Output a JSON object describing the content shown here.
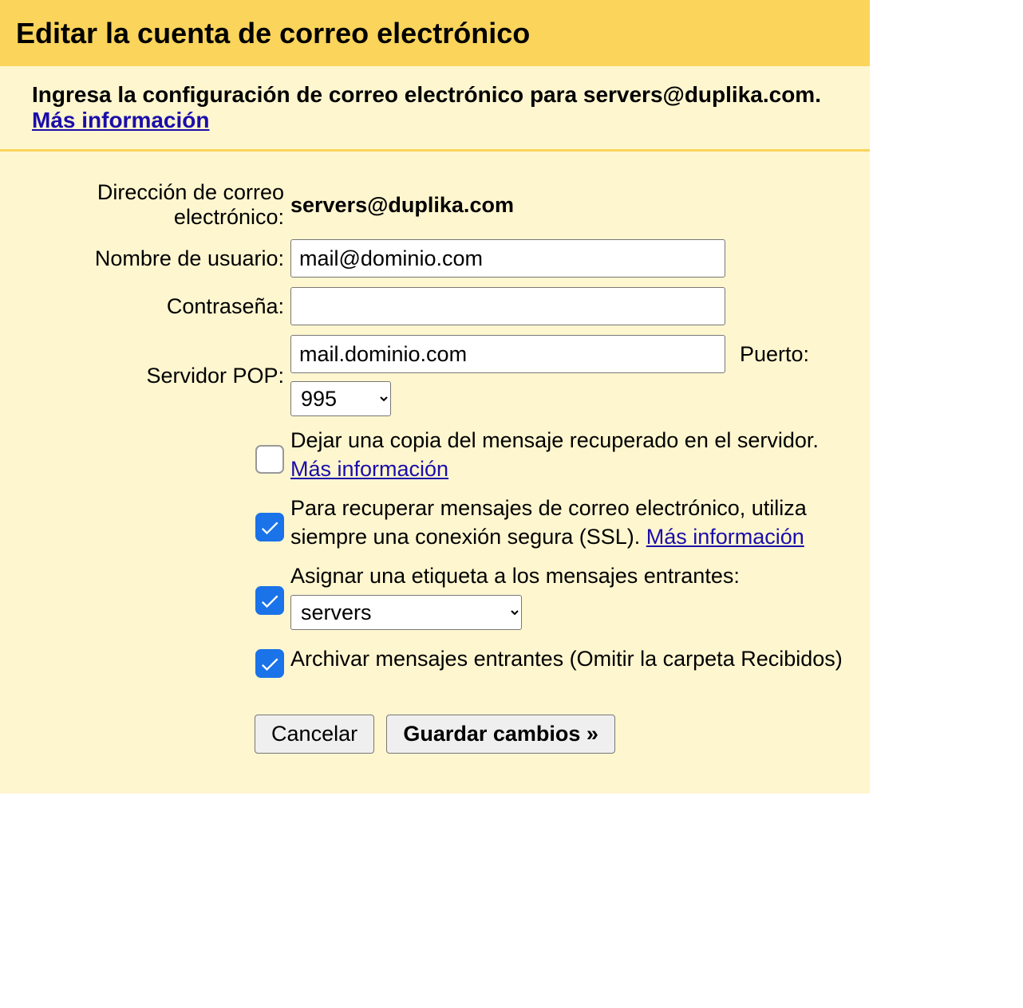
{
  "header": {
    "title": "Editar la cuenta de correo electrónico"
  },
  "intro": {
    "text_before": "Ingresa la configuración de correo electrónico para servers@duplika.com. ",
    "link": "Más información"
  },
  "form": {
    "email_label": "Dirección de correo electrónico:",
    "email_value": "servers@duplika.com",
    "username_label": "Nombre de usuario:",
    "username_value": "mail@dominio.com",
    "password_label": "Contraseña:",
    "password_value": "",
    "pop_label": "Servidor POP:",
    "pop_value": "mail.dominio.com",
    "port_label": "Puerto:",
    "port_value": "995"
  },
  "options": {
    "leave_copy": {
      "checked": false,
      "text": "Dejar una copia del mensaje recuperado en el servidor. ",
      "link": "Más información"
    },
    "ssl": {
      "checked": true,
      "text": "Para recuperar mensajes de correo electrónico, utiliza siempre una conexión segura (SSL). ",
      "link": "Más información"
    },
    "label": {
      "checked": true,
      "text": "Asignar una etiqueta a los mensajes entrantes:",
      "select_value": "servers"
    },
    "archive": {
      "checked": true,
      "text": "Archivar mensajes entrantes (Omitir la carpeta Recibidos)"
    }
  },
  "buttons": {
    "cancel": "Cancelar",
    "save": "Guardar cambios »"
  }
}
